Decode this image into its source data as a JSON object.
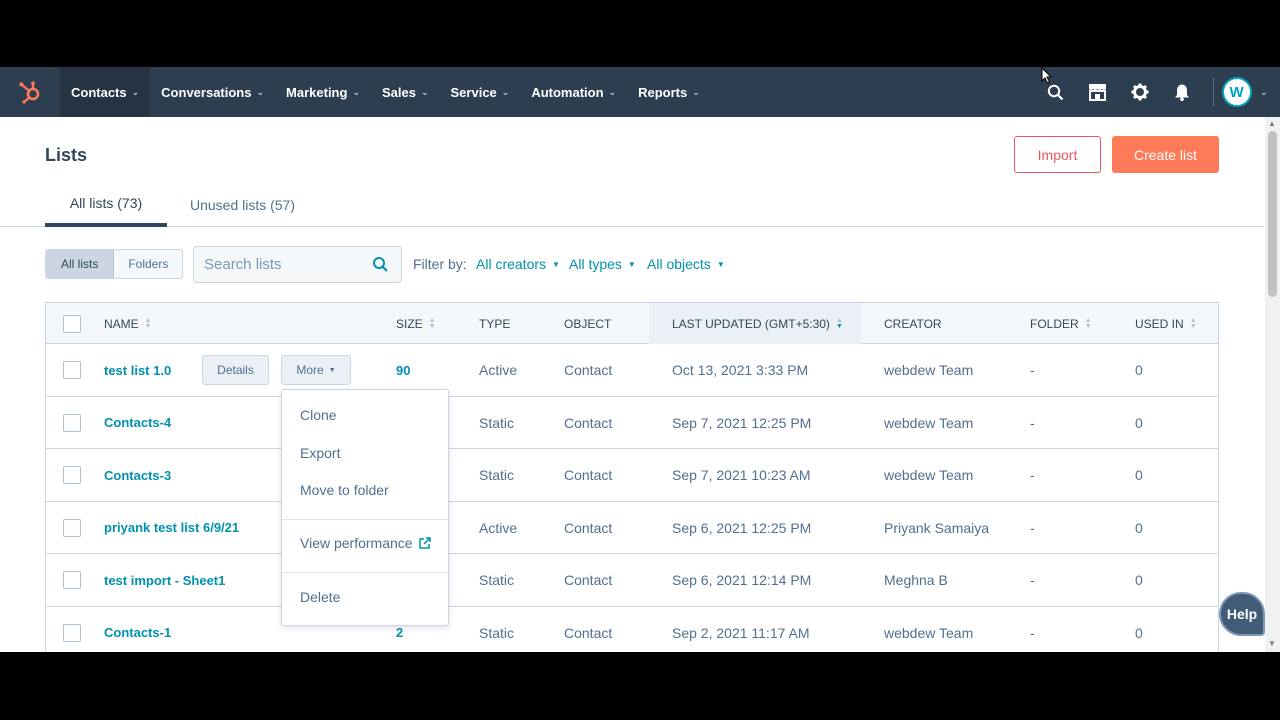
{
  "nav": {
    "items": [
      {
        "label": "Contacts",
        "active": true
      },
      {
        "label": "Conversations"
      },
      {
        "label": "Marketing"
      },
      {
        "label": "Sales"
      },
      {
        "label": "Service"
      },
      {
        "label": "Automation"
      },
      {
        "label": "Reports"
      }
    ],
    "avatar_letter": "W"
  },
  "page": {
    "title": "Lists",
    "import_label": "Import",
    "create_label": "Create list"
  },
  "tabs": {
    "all": "All lists (73)",
    "unused": "Unused lists (57)"
  },
  "filters": {
    "seg_all": "All lists",
    "seg_folders": "Folders",
    "search_placeholder": "Search lists",
    "label": "Filter by:",
    "creators": "All creators",
    "types": "All types",
    "objects": "All objects"
  },
  "table": {
    "headers": {
      "name": "NAME",
      "size": "SIZE",
      "type": "TYPE",
      "object": "OBJECT",
      "updated": "LAST UPDATED (GMT+5:30)",
      "creator": "CREATOR",
      "folder": "FOLDER",
      "used": "USED IN"
    },
    "details_label": "Details",
    "more_label": "More",
    "rows": [
      {
        "name": "test list 1.0",
        "size": "90",
        "type": "Active",
        "object": "Contact",
        "updated": "Oct 13, 2021 3:33 PM",
        "creator": "webdew Team",
        "folder": "-",
        "used": "0"
      },
      {
        "name": "Contacts-4",
        "size": "",
        "type": "Static",
        "object": "Contact",
        "updated": "Sep 7, 2021 12:25 PM",
        "creator": "webdew Team",
        "folder": "-",
        "used": "0"
      },
      {
        "name": "Contacts-3",
        "size": "",
        "type": "Static",
        "object": "Contact",
        "updated": "Sep 7, 2021 10:23 AM",
        "creator": "webdew Team",
        "folder": "-",
        "used": "0"
      },
      {
        "name": "priyank test list 6/9/21",
        "size": "",
        "type": "Active",
        "object": "Contact",
        "updated": "Sep 6, 2021 12:25 PM",
        "creator": "Priyank Samaiya",
        "folder": "-",
        "used": "0"
      },
      {
        "name": "test import - Sheet1",
        "size": "",
        "type": "Static",
        "object": "Contact",
        "updated": "Sep 6, 2021 12:14 PM",
        "creator": "Meghna B",
        "folder": "-",
        "used": "0"
      },
      {
        "name": "Contacts-1",
        "size": "2",
        "type": "Static",
        "object": "Contact",
        "updated": "Sep 2, 2021 11:17 AM",
        "creator": "webdew Team",
        "folder": "-",
        "used": "0"
      }
    ]
  },
  "menu": {
    "clone": "Clone",
    "export": "Export",
    "move": "Move to folder",
    "performance": "View performance",
    "delete": "Delete"
  },
  "help_label": "Help",
  "colors": {
    "nav_bg": "#2d3e50",
    "link": "#0091ae",
    "accent": "#ff7a59",
    "import_border": "#f2545b"
  }
}
